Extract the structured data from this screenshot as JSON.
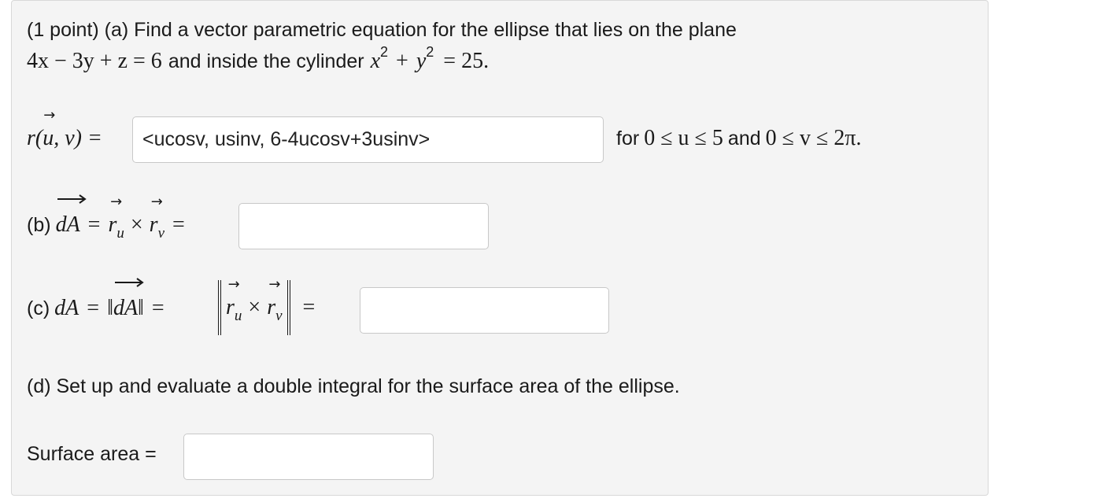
{
  "problem": {
    "intro": "(1 point) (a) Find a vector parametric equation for the ellipse that lies on the plane",
    "plane_eq": "4x − 3y + z = 6",
    "and_inside": "and inside the cylinder",
    "cyl_x": "x",
    "cyl_plus": "+",
    "cyl_y": "y",
    "cyl_exp": "2",
    "cyl_rhs": "= 25."
  },
  "part_a": {
    "lhs": "r(u, v) =",
    "value": "<ucosv, usinv, 6-4ucosv+3usinv>",
    "for_text": "for",
    "u_range": "0 ≤ u ≤ 5",
    "and_text": "and",
    "v_range": "0 ≤ v ≤ 2π."
  },
  "part_b": {
    "label": "(b)",
    "value": ""
  },
  "part_c": {
    "label": "(c)",
    "value": ""
  },
  "part_d": {
    "text": "(d) Set up and evaluate a double integral for the surface area of the ellipse.",
    "surface_label": "Surface area =",
    "value": ""
  }
}
